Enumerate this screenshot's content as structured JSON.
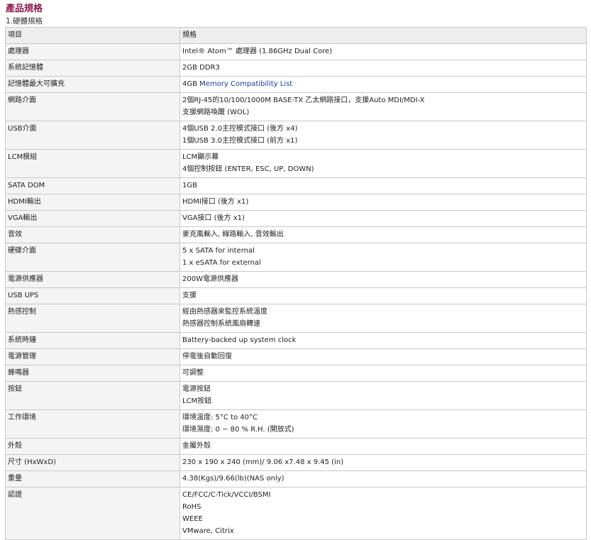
{
  "page_title": "產品規格",
  "section_title": "1.硬體規格",
  "table": {
    "headers": [
      "項目",
      "規格"
    ],
    "rows": [
      {
        "item": "處理器",
        "lines": [
          "Intel® Atom™ 處理器 (1.86GHz Dual Core)"
        ]
      },
      {
        "item": "系統記憶體",
        "lines": [
          "2GB DDR3"
        ]
      },
      {
        "item": "記憶體最大可擴充",
        "lines": [
          "4GB"
        ],
        "link": "Memory Compatibility List"
      },
      {
        "item": "網路介面",
        "lines": [
          "2個RJ-45的10/100/1000M BASE-TX 乙太網路接口，支援Auto MDI/MDI-X",
          "支援網路喚醒 (WOL)"
        ]
      },
      {
        "item": "USB介面",
        "lines": [
          "4個USB 2.0主控模式接口 (後方 x4)",
          "1個USB 3.0主控模式接口 (前方 x1)"
        ]
      },
      {
        "item": "LCM模組",
        "lines": [
          "LCM顯示幕",
          "4個控制按鈕 (ENTER, ESC, UP, DOWN)"
        ]
      },
      {
        "item": "SATA DOM",
        "lines": [
          "1GB"
        ]
      },
      {
        "item": "HDMI輸出",
        "lines": [
          "HDMI接口 (後方 x1)"
        ]
      },
      {
        "item": "VGA輸出",
        "lines": [
          "VGA接口 (後方 x1)"
        ]
      },
      {
        "item": "音效",
        "lines": [
          "麥克風輸入, 線路輸入, 音效輸出"
        ]
      },
      {
        "item": "硬碟介面",
        "lines": [
          "5 x SATA for internal",
          "1 x eSATA for external"
        ]
      },
      {
        "item": "電源供應器",
        "lines": [
          "200W電源供應器"
        ]
      },
      {
        "item": "USB UPS",
        "lines": [
          "支援"
        ]
      },
      {
        "item": "熱感控制",
        "lines": [
          "經由熱感器來監控系統溫度",
          "熱感器控制系統風扇轉速"
        ]
      },
      {
        "item": "系統時鐘",
        "lines": [
          "Battery-backed up system clock"
        ]
      },
      {
        "item": "電源管理",
        "lines": [
          "停電後自動回復"
        ]
      },
      {
        "item": "蜂鳴器",
        "lines": [
          "可調整"
        ]
      },
      {
        "item": "按鈕",
        "lines": [
          "電源按鈕",
          "LCM按鈕"
        ]
      },
      {
        "item": "工作環境",
        "lines": [
          "環境溫度: 5°C to 40°C",
          "環境濕度: 0 ~ 80 % R.H. (開放式)"
        ]
      },
      {
        "item": "外殼",
        "lines": [
          "金屬外殼"
        ]
      },
      {
        "item": "尺寸 (HxWxD)",
        "lines": [
          "230 x 190 x 240 (mm)/ 9.06 x7.48 x 9.45 (in)"
        ]
      },
      {
        "item": "重量",
        "lines": [
          "4.38(Kgs)/9.66(lb)(NAS only)"
        ]
      },
      {
        "item": "認證",
        "lines": [
          "CE/FCC/C-Tick/VCCI/BSMI",
          "RoHS",
          "WEEE",
          "VMware, Citrix"
        ]
      }
    ]
  },
  "colors": {
    "title": "#8b1a4a",
    "link": "#1a3a9a",
    "border": "#c9c9c9",
    "header_bg": "#eeeeee",
    "item_bg": "#f4f4f4"
  }
}
